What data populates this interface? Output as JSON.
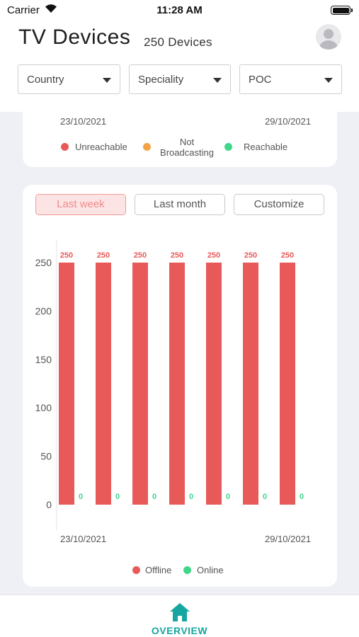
{
  "status_bar": {
    "carrier": "Carrier",
    "time": "11:28 AM"
  },
  "header": {
    "title": "TV Devices",
    "device_count": "250 Devices"
  },
  "filters": [
    {
      "label": "Country"
    },
    {
      "label": "Speciality"
    },
    {
      "label": "POC"
    }
  ],
  "status_card": {
    "date_start": "23/10/2021",
    "date_end": "29/10/2021",
    "legend": [
      {
        "label": "Unreachable",
        "color": "#e85a5a"
      },
      {
        "label": "Not\nBroadcasting",
        "color": "#f4a348"
      },
      {
        "label": "Reachable",
        "color": "#3fd68a"
      }
    ]
  },
  "range_buttons": [
    {
      "label": "Last week",
      "active": true
    },
    {
      "label": "Last month",
      "active": false
    },
    {
      "label": "Customize",
      "active": false
    }
  ],
  "chart_data": {
    "type": "bar",
    "categories": [
      "",
      "",
      "",
      "",
      "",
      "",
      ""
    ],
    "series": [
      {
        "name": "Offline",
        "color": "#e85a5a",
        "values": [
          250,
          250,
          250,
          250,
          250,
          250,
          250
        ]
      },
      {
        "name": "Online",
        "color": "#3fd68a",
        "values": [
          0,
          0,
          0,
          0,
          0,
          0,
          0
        ]
      }
    ],
    "ylim": [
      0,
      250
    ],
    "yticks": [
      0,
      50,
      100,
      150,
      200,
      250
    ],
    "date_start": "23/10/2021",
    "date_end": "29/10/2021",
    "title": "",
    "xlabel": "",
    "ylabel": "",
    "legend_position": "bottom"
  },
  "chart_legend": [
    {
      "label": "Offline",
      "color": "#e85a5a"
    },
    {
      "label": "Online",
      "color": "#3fd68a"
    }
  ],
  "bottom_nav": {
    "label": "OVERVIEW",
    "icon": "home-icon",
    "color": "#16a6a0"
  }
}
